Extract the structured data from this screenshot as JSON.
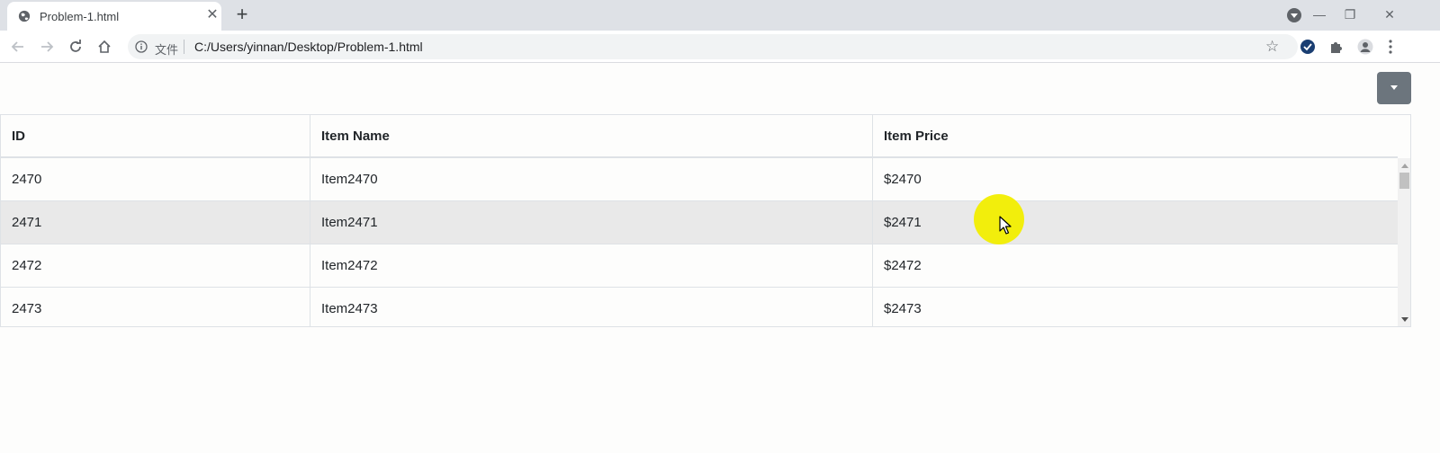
{
  "browser": {
    "tab_title": "Problem-1.html",
    "tab_close": "✕",
    "new_tab": "+",
    "address_scheme": "文件",
    "address_url": "C:/Users/yinnan/Desktop/Problem-1.html",
    "window_controls": {
      "minimize": "—",
      "restore": "❐",
      "close": "✕"
    }
  },
  "table": {
    "headers": [
      "ID",
      "Item Name",
      "Item Price"
    ],
    "rows": [
      {
        "id": "2470",
        "name": "Item2470",
        "price": "$2470"
      },
      {
        "id": "2471",
        "name": "Item2471",
        "price": "$2471"
      },
      {
        "id": "2472",
        "name": "Item2472",
        "price": "$2472"
      },
      {
        "id": "2473",
        "name": "Item2473",
        "price": "$2473"
      }
    ],
    "hovered_row_index": 1
  },
  "colors": {
    "dropdown_button": "#6c757d",
    "row_hover": "#e9e9e9",
    "cursor_highlight": "#f2ee00"
  }
}
